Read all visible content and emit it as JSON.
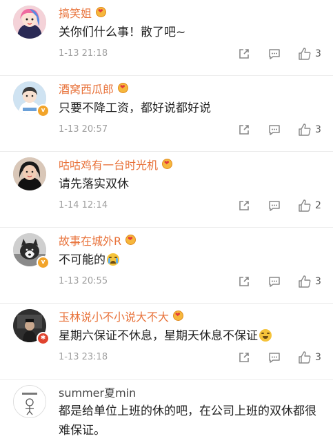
{
  "comments": [
    {
      "name": "搞笑姐",
      "text": "关你们什么事！散了吧~",
      "time": "1-13 21:18",
      "likes": "3"
    },
    {
      "name": "酒窝西瓜郎",
      "text": "只要不降工资，都好说都好说",
      "time": "1-13 20:57",
      "likes": "3"
    },
    {
      "name": "咕咕鸡有一台时光机",
      "text": "请先落实双休",
      "time": "1-14 12:14",
      "likes": "2"
    },
    {
      "name": "故事在城外R",
      "text": "不可能的",
      "time": "1-13 20:55",
      "likes": "3"
    },
    {
      "name": "玉林说小不小说大不大",
      "text": "星期六保证不休息，星期天休息不保证",
      "time": "1-13 23:18",
      "likes": "3"
    },
    {
      "name": "summer夏min",
      "text": "都是给单位上班的休的吧，在公司上班的双休都很难保证。"
    }
  ],
  "colors": {
    "name_accent": "#e8723a",
    "muted": "#a0a0a0",
    "verified_badge": "#f2a42a",
    "red_badge": "#e0432e"
  },
  "icons": {
    "share": "share-icon",
    "reply": "comment-icon",
    "like": "thumbs-up-icon",
    "medal": "heart-medal-icon"
  }
}
